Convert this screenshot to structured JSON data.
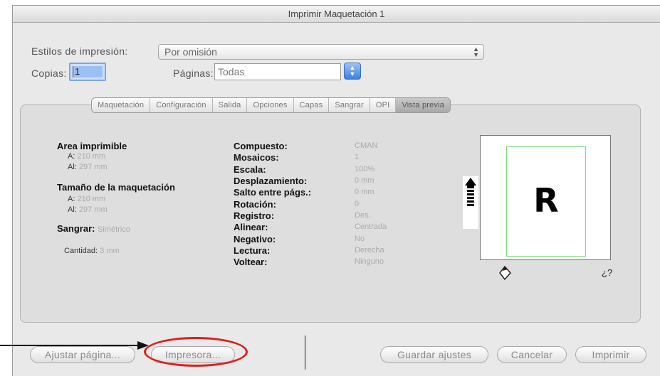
{
  "window": {
    "title": "Imprimir Maquetación 1"
  },
  "print_styles": {
    "label": "Estilos de impresión:",
    "value": "Por omisión"
  },
  "copies": {
    "label": "Copias:",
    "value": "1"
  },
  "pages": {
    "label": "Páginas:",
    "value": "Todas"
  },
  "tabs": [
    {
      "label": "Maquetación"
    },
    {
      "label": "Configuración"
    },
    {
      "label": "Salida"
    },
    {
      "label": "Opciones"
    },
    {
      "label": "Capas"
    },
    {
      "label": "Sangrar"
    },
    {
      "label": "OPI"
    },
    {
      "label": "Vista previa",
      "active": true
    }
  ],
  "printable_area": {
    "heading": "Area imprimible",
    "width_label": "A:",
    "width_value": "210 mm",
    "height_label": "Al:",
    "height_value": "297 mm"
  },
  "layout_size": {
    "heading": "Tamaño de la maquetación",
    "width_label": "A:",
    "width_value": "210 mm",
    "height_label": "Al:",
    "height_value": "297 mm"
  },
  "bleed": {
    "label": "Sangrar:",
    "value": "Simétrico"
  },
  "amount": {
    "label": "Cantidad:",
    "value": "3 mm"
  },
  "properties": [
    {
      "label": "Compuesto:",
      "value": "CMAN"
    },
    {
      "label": "Mosaicos:",
      "value": "1"
    },
    {
      "label": "Escala:",
      "value": "100%"
    },
    {
      "label": "Desplazamiento:",
      "value": "0 mm"
    },
    {
      "label": "Salto entre págs.:",
      "value": "0 mm"
    },
    {
      "label": "Rotación:",
      "value": "0"
    },
    {
      "label": "Registro:",
      "value": "Des."
    },
    {
      "label": "Alinear:",
      "value": "Centrada"
    },
    {
      "label": "Negativo:",
      "value": "No"
    },
    {
      "label": "Lectura:",
      "value": "Derecha"
    },
    {
      "label": "Voltear:",
      "value": "Ninguno"
    }
  ],
  "preview": {
    "letter": "R",
    "help": "¿?"
  },
  "buttons": {
    "page_setup": "Ajustar página...",
    "printer": "Impresora...",
    "save_settings": "Guardar ajustes",
    "cancel": "Cancelar",
    "print": "Imprimir"
  },
  "colors": {
    "highlight_oval": "#e31b1b",
    "page_outline": "#76e076",
    "copies_focus": "#9cc0f3"
  }
}
